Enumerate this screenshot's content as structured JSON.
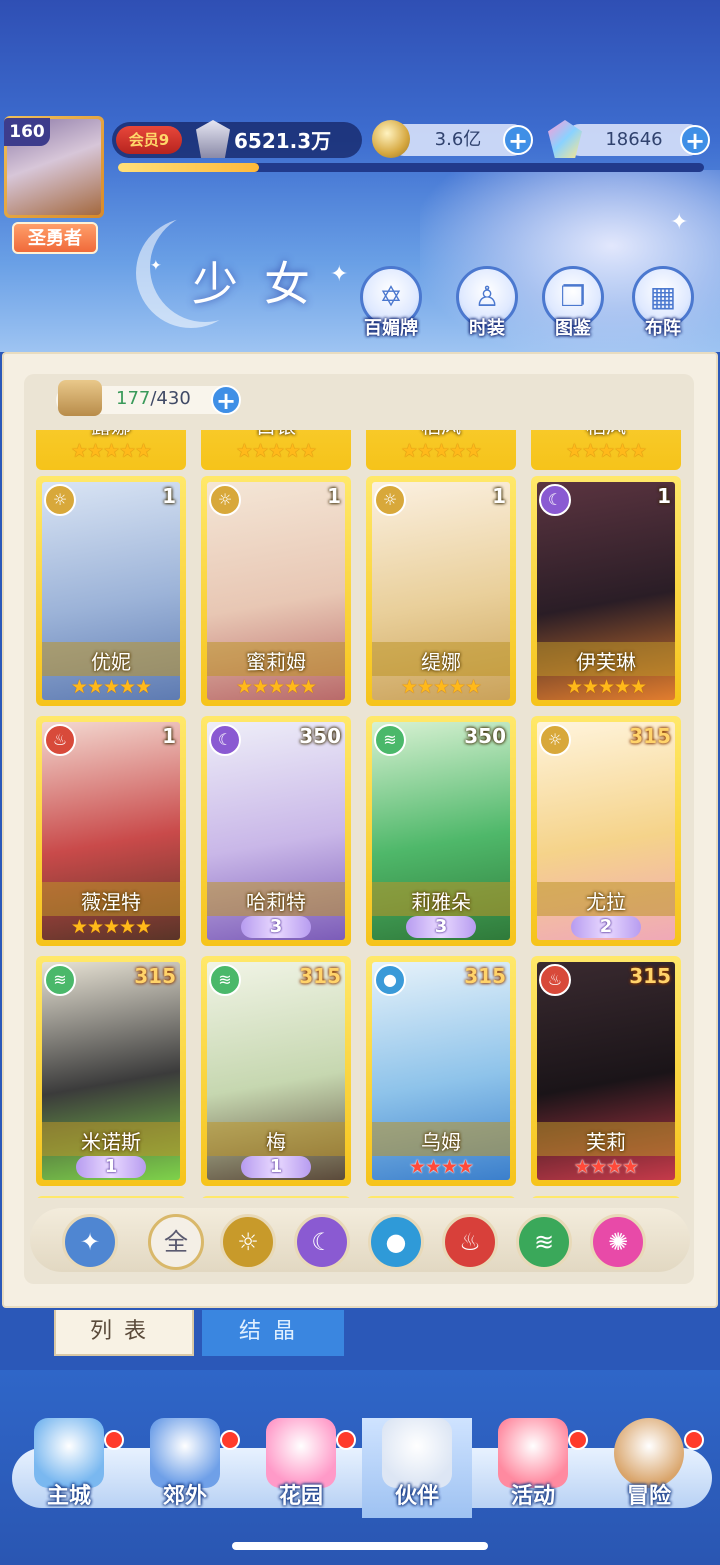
{
  "player": {
    "level": "160",
    "title": "圣勇者",
    "vip": "会员9",
    "power": "6521.3万",
    "exp_fraction": 0.24
  },
  "resources": {
    "gold": "3.6亿",
    "gems": "18646"
  },
  "page_title": "少女",
  "functions": [
    {
      "label": "百媚牌",
      "icon": "card-icon"
    },
    {
      "label": "时装",
      "icon": "costume-icon"
    },
    {
      "label": "图鉴",
      "icon": "book-icon"
    },
    {
      "label": "布阵",
      "icon": "grid-icon"
    }
  ],
  "inventory": {
    "current": "177",
    "max": "/430"
  },
  "partial_row_names": [
    "露娜",
    "白银",
    "稻风",
    "稻风"
  ],
  "cards": [
    {
      "name": "优妮",
      "count": "1",
      "element": "light",
      "rank_type": "stars",
      "rank": 5,
      "art": [
        "#d9e4f4",
        "#9cb3d8",
        "#5e7bb2"
      ]
    },
    {
      "name": "蜜莉姆",
      "count": "1",
      "element": "light",
      "rank_type": "stars",
      "rank": 5,
      "art": [
        "#f4e6d6",
        "#e8c7b4",
        "#b96a6a"
      ]
    },
    {
      "name": "缇娜",
      "count": "1",
      "element": "light",
      "rank_type": "stars",
      "rank": 5,
      "art": [
        "#fbf0e0",
        "#e9cf9a",
        "#caa25a"
      ]
    },
    {
      "name": "伊芙琳",
      "count": "1",
      "element": "moon",
      "rank_type": "stars",
      "rank": 5,
      "art": [
        "#5b3440",
        "#2a1d26",
        "#e27d2e"
      ]
    },
    {
      "name": "薇涅特",
      "count": "1",
      "element": "fire",
      "rank_type": "stars",
      "rank": 5,
      "art": [
        "#f3d8d0",
        "#c94a4a",
        "#5a3428"
      ]
    },
    {
      "name": "哈莉特",
      "count": "350",
      "element": "moon",
      "rank_type": "wing",
      "rank": "3",
      "art": [
        "#eeeef8",
        "#c9b7e8",
        "#7c5cb8"
      ]
    },
    {
      "name": "莉雅朵",
      "count": "350",
      "element": "wind",
      "rank_type": "wing",
      "rank": "3",
      "art": [
        "#d7f1d2",
        "#4fb86a",
        "#2f7a3a"
      ]
    },
    {
      "name": "尤拉",
      "count": "315",
      "element": "light",
      "rank_type": "wing",
      "rank": "2",
      "art": [
        "#fff4dc",
        "#f5d38a",
        "#f0a8b8"
      ]
    },
    {
      "name": "米诺斯",
      "count": "315",
      "element": "wind",
      "rank_type": "wing",
      "rank": "1",
      "art": [
        "#e7e2d4",
        "#3b3b3b",
        "#7ed24a"
      ]
    },
    {
      "name": "梅",
      "count": "315",
      "element": "wind",
      "rank_type": "wing",
      "rank": "1",
      "art": [
        "#f1f4e6",
        "#c6d7b0",
        "#5b4a3a"
      ]
    },
    {
      "name": "乌姆",
      "count": "315",
      "element": "water",
      "rank_type": "red_stars",
      "rank": 4,
      "art": [
        "#e6f2fa",
        "#8ec3ea",
        "#3b7fcc"
      ]
    },
    {
      "name": "芙莉",
      "count": "315",
      "element": "fire",
      "rank_type": "red_stars",
      "rank": 4,
      "art": [
        "#3a2a30",
        "#1a1418",
        "#c63a4a"
      ]
    }
  ],
  "filters": [
    {
      "name": "filter-wing-icon",
      "label": "",
      "color": "#4f86d2"
    },
    {
      "name": "filter-all-button",
      "label": "全",
      "color": "#f4efe6"
    },
    {
      "name": "filter-light-icon",
      "label": "",
      "color": "#c89a2a"
    },
    {
      "name": "filter-moon-icon",
      "label": "",
      "color": "#8a5ad2"
    },
    {
      "name": "filter-water-icon",
      "label": "",
      "color": "#2f9ad8"
    },
    {
      "name": "filter-fire-icon",
      "label": "",
      "color": "#d8403a"
    },
    {
      "name": "filter-wind-icon",
      "label": "",
      "color": "#3aa85a"
    },
    {
      "name": "filter-star-icon",
      "label": "",
      "color": "#e84aa8"
    }
  ],
  "tabs": {
    "list": "列表",
    "crystal": "结晶"
  },
  "nav": [
    {
      "label": "主城",
      "badge": true,
      "active": false
    },
    {
      "label": "郊外",
      "badge": true,
      "active": false
    },
    {
      "label": "花园",
      "badge": true,
      "active": false
    },
    {
      "label": "伙伴",
      "badge": false,
      "active": true
    },
    {
      "label": "活动",
      "badge": true,
      "active": false
    },
    {
      "label": "冒险",
      "badge": true,
      "active": false
    }
  ],
  "colors": {
    "light": "#d8a83a",
    "moon": "#8a5ad2",
    "fire": "#d84a3a",
    "wind": "#4ab86a",
    "water": "#3a9ad8"
  }
}
